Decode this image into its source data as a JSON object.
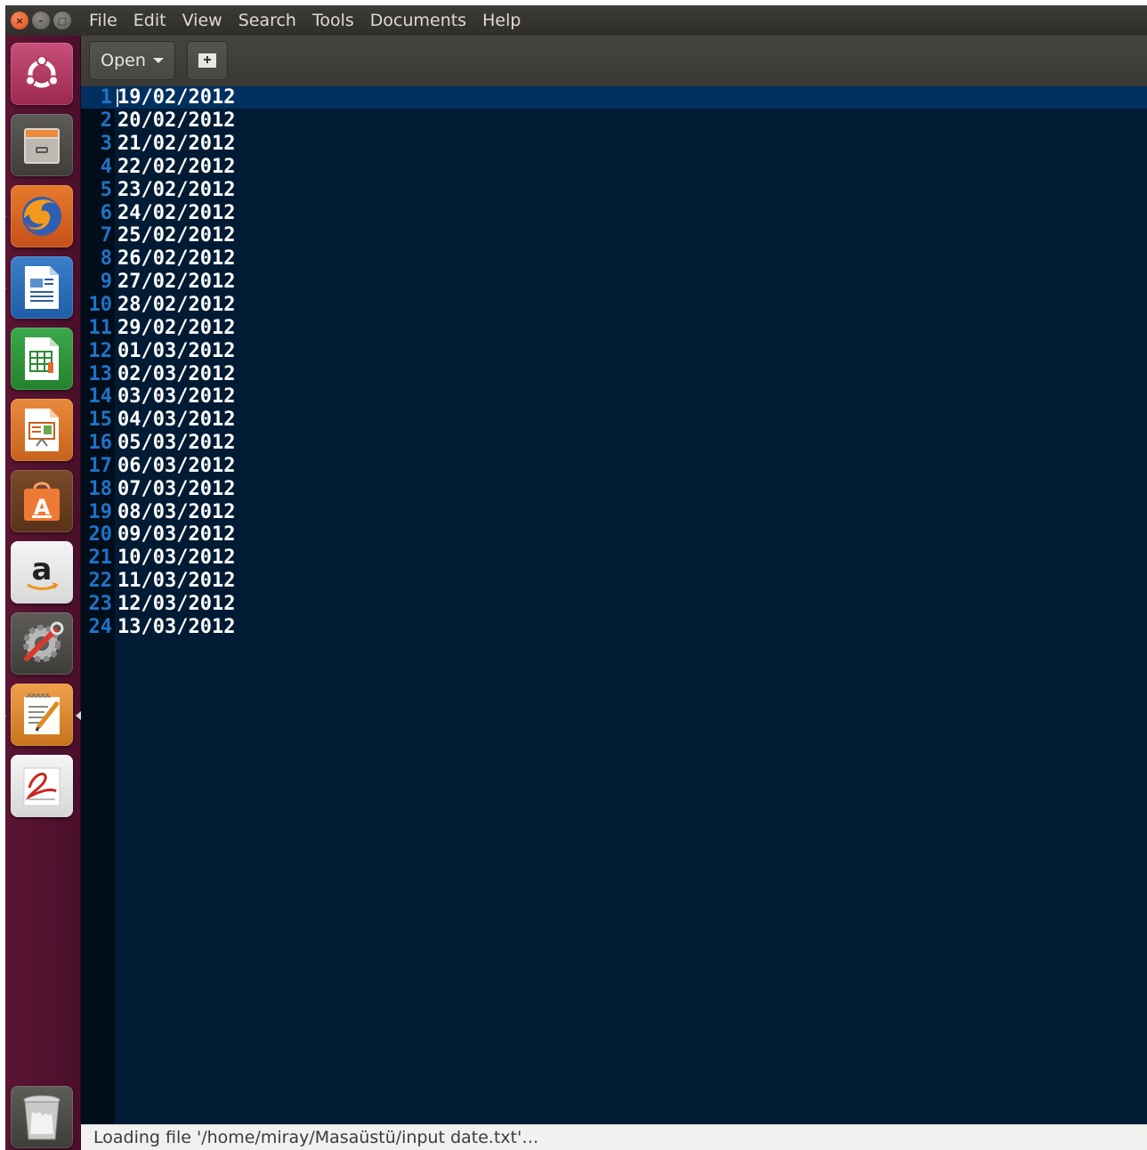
{
  "window": {
    "close_glyph": "×",
    "minimize_glyph": "–",
    "maximize_glyph": "□"
  },
  "menu": [
    {
      "label": "File"
    },
    {
      "label": "Edit"
    },
    {
      "label": "View"
    },
    {
      "label": "Search"
    },
    {
      "label": "Tools"
    },
    {
      "label": "Documents"
    },
    {
      "label": "Help"
    }
  ],
  "toolbar": {
    "open_label": "Open"
  },
  "launcher": [
    {
      "name": "ubuntu-dash-icon"
    },
    {
      "name": "files-icon"
    },
    {
      "name": "firefox-icon"
    },
    {
      "name": "writer-icon"
    },
    {
      "name": "calc-icon"
    },
    {
      "name": "impress-icon"
    },
    {
      "name": "software-center-icon"
    },
    {
      "name": "amazon-icon"
    },
    {
      "name": "system-settings-icon"
    },
    {
      "name": "text-editor-icon"
    },
    {
      "name": "document-viewer-icon"
    },
    {
      "name": "trash-icon"
    }
  ],
  "editor": {
    "lines": [
      {
        "n": "1",
        "text": "19/02/2012"
      },
      {
        "n": "2",
        "text": "20/02/2012"
      },
      {
        "n": "3",
        "text": "21/02/2012"
      },
      {
        "n": "4",
        "text": "22/02/2012"
      },
      {
        "n": "5",
        "text": "23/02/2012"
      },
      {
        "n": "6",
        "text": "24/02/2012"
      },
      {
        "n": "7",
        "text": "25/02/2012"
      },
      {
        "n": "8",
        "text": "26/02/2012"
      },
      {
        "n": "9",
        "text": "27/02/2012"
      },
      {
        "n": "10",
        "text": "28/02/2012"
      },
      {
        "n": "11",
        "text": "29/02/2012"
      },
      {
        "n": "12",
        "text": "01/03/2012"
      },
      {
        "n": "13",
        "text": "02/03/2012"
      },
      {
        "n": "14",
        "text": "03/03/2012"
      },
      {
        "n": "15",
        "text": "04/03/2012"
      },
      {
        "n": "16",
        "text": "05/03/2012"
      },
      {
        "n": "17",
        "text": "06/03/2012"
      },
      {
        "n": "18",
        "text": "07/03/2012"
      },
      {
        "n": "19",
        "text": "08/03/2012"
      },
      {
        "n": "20",
        "text": "09/03/2012"
      },
      {
        "n": "21",
        "text": "10/03/2012"
      },
      {
        "n": "22",
        "text": "11/03/2012"
      },
      {
        "n": "23",
        "text": "12/03/2012"
      },
      {
        "n": "24",
        "text": "13/03/2012"
      }
    ]
  },
  "status": {
    "text": "Loading file '/home/miray/Masaüstü/input  date.txt'…"
  },
  "colors": {
    "editor_bg": "#001b33",
    "line_number": "#1f74c8",
    "current_line": "#003060",
    "launcher_bg": "#5a1533"
  }
}
